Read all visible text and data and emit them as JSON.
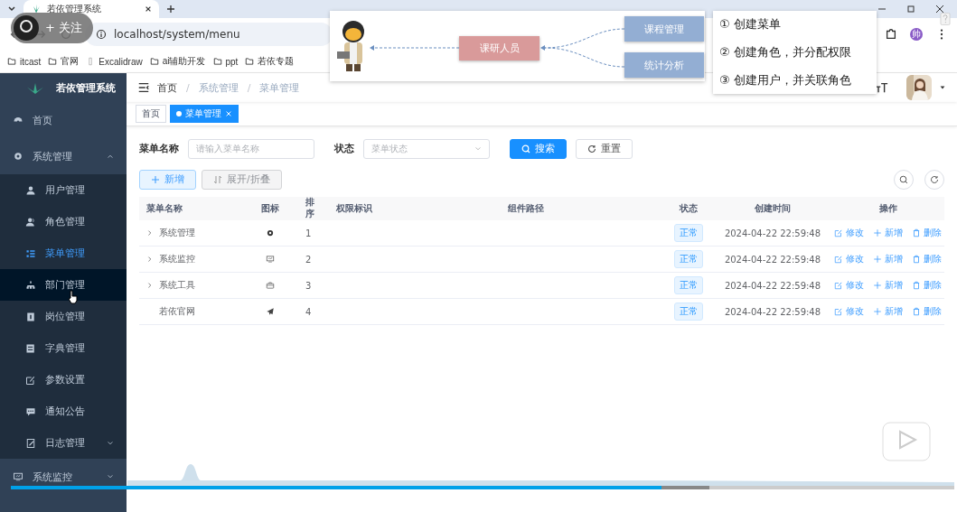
{
  "browser": {
    "tab_title": "若依管理系统",
    "address": "localhost/system/menu",
    "profile_initial": "帅",
    "bookmarks": [
      {
        "kind": "folder",
        "label": "itcast"
      },
      {
        "kind": "folder",
        "label": "官网"
      },
      {
        "kind": "page",
        "label": "Excalidraw"
      },
      {
        "kind": "folder",
        "label": "ai辅助开发"
      },
      {
        "kind": "folder",
        "label": "ppt"
      },
      {
        "kind": "folder",
        "label": "若依专题"
      }
    ]
  },
  "follow_badge": {
    "label": "+ 关注"
  },
  "diagram": {
    "center": "课研人员",
    "nodes": [
      "课程管理",
      "统计分析"
    ]
  },
  "steps": [
    "①  创建菜单",
    "②  创建角色，并分配权限",
    "③  创建用户，并关联角色"
  ],
  "sidebar": {
    "title": "若依管理系统",
    "items": [
      {
        "label": "首页",
        "selected": false
      },
      {
        "label": "系统管理",
        "selected": false,
        "expanded": true,
        "children": [
          {
            "label": "用户管理",
            "selected": false,
            "hovered": false
          },
          {
            "label": "角色管理",
            "selected": false,
            "hovered": false
          },
          {
            "label": "菜单管理",
            "selected": true,
            "hovered": false
          },
          {
            "label": "部门管理",
            "selected": false,
            "hovered": true
          },
          {
            "label": "岗位管理",
            "selected": false,
            "hovered": false
          },
          {
            "label": "字典管理",
            "selected": false,
            "hovered": false
          },
          {
            "label": "参数设置",
            "selected": false,
            "hovered": false
          },
          {
            "label": "通知公告",
            "selected": false,
            "hovered": false
          },
          {
            "label": "日志管理",
            "selected": false,
            "hovered": false,
            "expanded": false
          }
        ]
      },
      {
        "label": "系统监控",
        "selected": false,
        "expanded": false
      }
    ]
  },
  "breadcrumb": [
    "首页",
    "系统管理",
    "菜单管理"
  ],
  "breadcrumb_separator": "/",
  "tags": [
    {
      "label": "首页",
      "selected": false
    },
    {
      "label": "菜单管理",
      "selected": true
    }
  ],
  "search_form": {
    "fields": [
      {
        "label": "菜单名称",
        "placeholder": "请输入菜单名称",
        "kind": "input"
      },
      {
        "label": "状态",
        "placeholder": "菜单状态",
        "kind": "select"
      }
    ],
    "search": "搜索",
    "reset": "重置"
  },
  "toolbar": {
    "add": "新增",
    "toggle": "展开/折叠"
  },
  "table": {
    "columns": [
      "菜单名称",
      "图标",
      "排序",
      "权限标识",
      "组件路径",
      "状态",
      "创建时间",
      "操作"
    ],
    "rows": [
      {
        "name": "系统管理",
        "expanded": false,
        "order": "1",
        "status": "正常",
        "created": "2024-04-22 22:59:48",
        "actions": [
          "修改",
          "新增",
          "删除"
        ]
      },
      {
        "name": "系统监控",
        "expanded": false,
        "order": "2",
        "status": "正常",
        "created": "2024-04-22 22:59:48",
        "actions": [
          "修改",
          "新增",
          "删除"
        ]
      },
      {
        "name": "系统工具",
        "expanded": false,
        "order": "3",
        "status": "正常",
        "created": "2024-04-22 22:59:48",
        "actions": [
          "修改",
          "新增",
          "删除"
        ]
      },
      {
        "name": "若依官网",
        "order": "4",
        "status": "正常",
        "created": "2024-04-22 22:59:48",
        "actions": [
          "修改",
          "新增",
          "删除"
        ]
      }
    ]
  },
  "video": {
    "level": 0.69
  }
}
